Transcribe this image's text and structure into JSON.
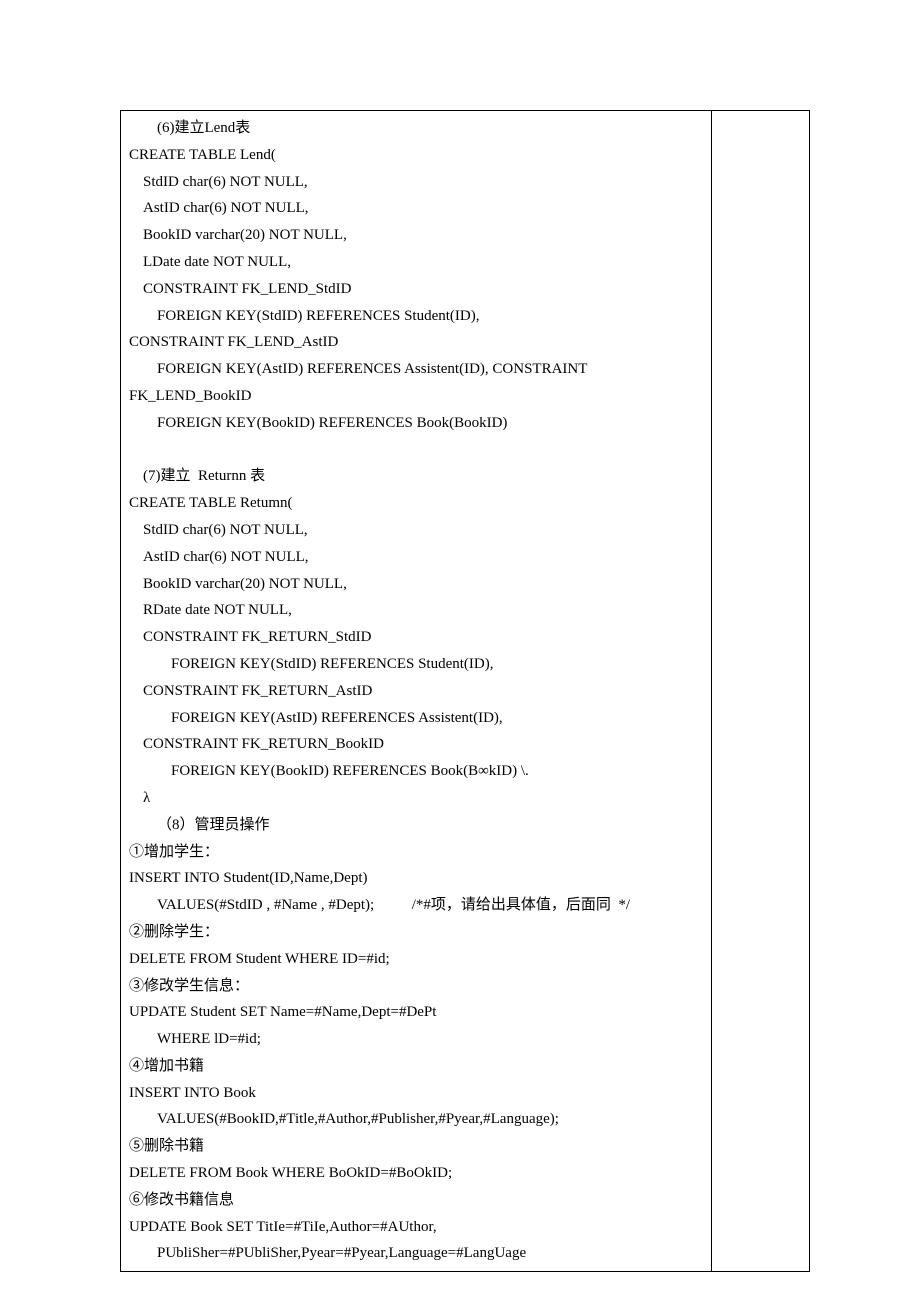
{
  "lines": [
    {
      "cls": "ind2",
      "text": "(6)建立Lend表"
    },
    {
      "cls": "",
      "text": "CREATE TABLE Lend("
    },
    {
      "cls": "ind1",
      "text": "StdID char(6) NOT NULL,"
    },
    {
      "cls": "ind1",
      "text": "AstID char(6) NOT NULL,"
    },
    {
      "cls": "ind1",
      "text": "BookID varchar(20) NOT NULL,"
    },
    {
      "cls": "ind1",
      "text": "LDate date NOT NULL,"
    },
    {
      "cls": "ind1",
      "text": "CONSTRAINT FK_LEND_StdID"
    },
    {
      "cls": "ind2",
      "text": "FOREIGN KEY(StdID) REFERENCES Student(ID),"
    },
    {
      "cls": "",
      "text": "CONSTRAINT FK_LEND_AstID"
    },
    {
      "cls": "ind2",
      "text": "FOREIGN KEY(AstID) REFERENCES Assistent(ID), CONSTRAINT"
    },
    {
      "cls": "",
      "text": "FK_LEND_BookID"
    },
    {
      "cls": "ind2",
      "text": "FOREIGN KEY(BookID) REFERENCES Book(BookID)"
    },
    {
      "cls": "blank",
      "text": ""
    },
    {
      "cls": "ind1",
      "text": "(7)建立  Returnn 表"
    },
    {
      "cls": "",
      "text": "CREATE TABLE Retumn("
    },
    {
      "cls": "ind1",
      "text": "StdID char(6) NOT NULL,"
    },
    {
      "cls": "ind1",
      "text": "AstID char(6) NOT NULL,"
    },
    {
      "cls": "ind1",
      "text": "BookID varchar(20) NOT NULL,"
    },
    {
      "cls": "ind1",
      "text": "RDate date NOT NULL,"
    },
    {
      "cls": "ind1",
      "text": "CONSTRAINT FK_RETURN_StdID"
    },
    {
      "cls": "ind3",
      "text": "FOREIGN KEY(StdID) REFERENCES Student(ID),"
    },
    {
      "cls": "ind1",
      "text": "CONSTRAINT FK_RETURN_AstID"
    },
    {
      "cls": "ind3",
      "text": "FOREIGN KEY(AstID) REFERENCES Assistent(ID),"
    },
    {
      "cls": "ind1",
      "text": "CONSTRAINT FK_RETURN_BookID"
    },
    {
      "cls": "ind3",
      "text": "FOREIGN KEY(BookID) REFERENCES Book(B∞kID) \\."
    },
    {
      "cls": "ind1",
      "text": "λ"
    },
    {
      "cls": "ind2",
      "text": "（8）管理员操作"
    },
    {
      "cls": "",
      "text": "①增加学生："
    },
    {
      "cls": "",
      "text": "INSERT INTO Student(ID,Name,Dept)"
    },
    {
      "cls": "ind2",
      "text": "VALUES(#StdID , #Name , #Dept);          /*#项，请给出具体值，后面同  */"
    },
    {
      "cls": "",
      "text": "②删除学生："
    },
    {
      "cls": "",
      "text": "DELETE FROM Student WHERE ID=#id;"
    },
    {
      "cls": "",
      "text": "③修改学生信息："
    },
    {
      "cls": "",
      "text": "UPDATE Student SET Name=#Name,Dept=#DePt"
    },
    {
      "cls": "ind2",
      "text": "WHERE lD=#id;"
    },
    {
      "cls": "",
      "text": "④增加书籍"
    },
    {
      "cls": "",
      "text": "INSERT INTO Book"
    },
    {
      "cls": "ind2",
      "text": "VALUES(#BookID,#Title,#Author,#Publisher,#Pyear,#Language);"
    },
    {
      "cls": "",
      "text": "⑤删除书籍"
    },
    {
      "cls": "",
      "text": "DELETE FROM Book WHERE BoOkID=#BoOkID;"
    },
    {
      "cls": "",
      "text": "⑥修改书籍信息"
    },
    {
      "cls": "",
      "text": "UPDATE Book SET TitIe=#TiIe,Author=#AUthor,"
    },
    {
      "cls": "ind2",
      "text": "PUbliSher=#PUbliSher,Pyear=#Pyear,Language=#LangUage"
    }
  ]
}
